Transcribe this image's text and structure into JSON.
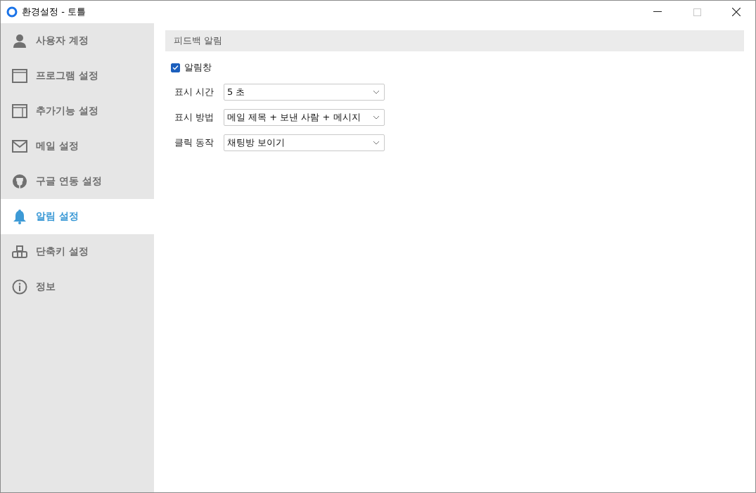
{
  "window": {
    "title": "환경설정 - 토틀"
  },
  "sidebar": {
    "items": [
      {
        "kind": "user",
        "label": "사용자 계정",
        "selected": false
      },
      {
        "kind": "window",
        "label": "프로그램 설정",
        "selected": false
      },
      {
        "kind": "panel",
        "label": "추가기능 설정",
        "selected": false
      },
      {
        "kind": "mail",
        "label": "메일 설정",
        "selected": false
      },
      {
        "kind": "plug",
        "label": "구글 연동 설정",
        "selected": false
      },
      {
        "kind": "bell",
        "label": "알림 설정",
        "selected": true
      },
      {
        "kind": "keys",
        "label": "단축키 설정",
        "selected": false
      },
      {
        "kind": "info",
        "label": "정보",
        "selected": false
      }
    ]
  },
  "section": {
    "title": "피드백 알림",
    "checkbox": {
      "label": "알림창",
      "checked": true
    },
    "fields": [
      {
        "label": "표시 시간",
        "value": "5 초"
      },
      {
        "label": "표시 방법",
        "value": "메일 제목 + 보낸 사람 + 메시지"
      },
      {
        "label": "클릭 동작",
        "value": "채팅방 보이기"
      }
    ]
  }
}
